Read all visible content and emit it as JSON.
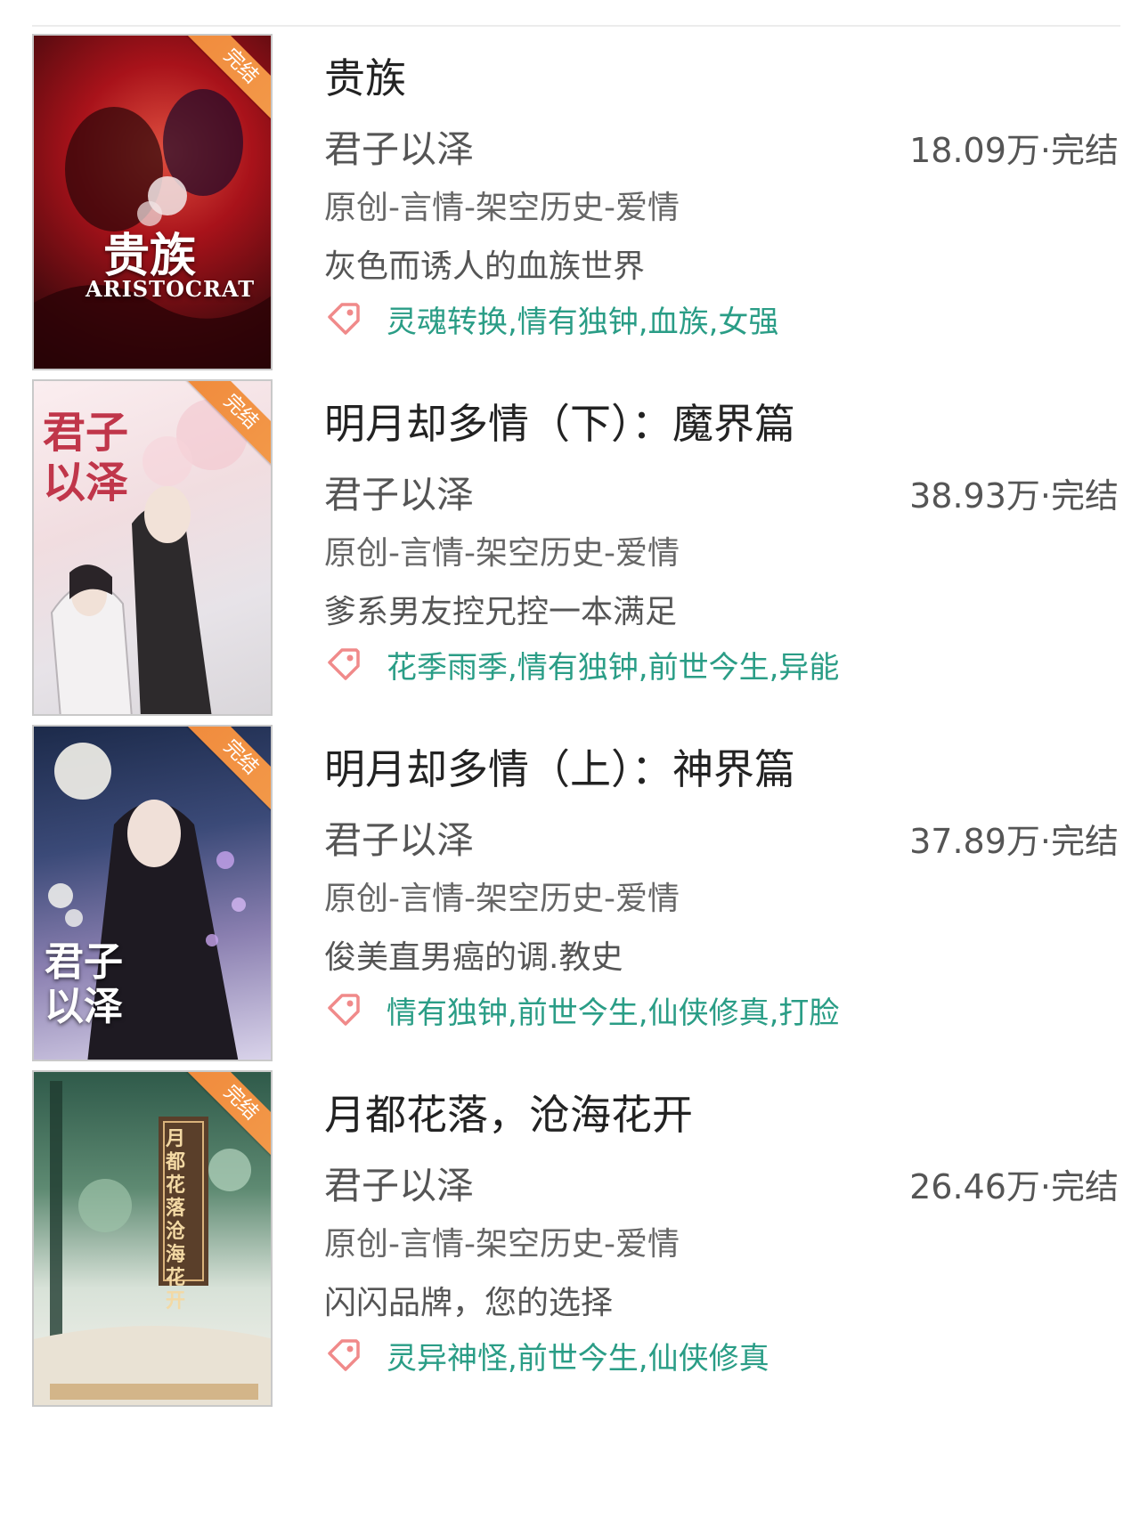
{
  "colors": {
    "tag_text": "#2a9d86",
    "ribbon": "#f08a3c",
    "tag_icon": "#f08a8a"
  },
  "books": [
    {
      "ribbon": "完结",
      "cover_text": "贵族",
      "cover_subtext": "ARISTOCRAT",
      "title": "贵族",
      "author": "君子以泽",
      "stats": "18.09万·完结",
      "category": "原创-言情-架空历史-爱情",
      "intro": "灰色而诱人的血族世界",
      "tags": "灵魂转换,情有独钟,血族,女强"
    },
    {
      "ribbon": "完结",
      "cover_text": "君子以泽",
      "title": "明月却多情（下）：魔界篇",
      "author": "君子以泽",
      "stats": "38.93万·完结",
      "category": "原创-言情-架空历史-爱情",
      "intro": "爹系男友控兄控一本满足",
      "tags": "花季雨季,情有独钟,前世今生,异能"
    },
    {
      "ribbon": "完结",
      "cover_text": "君子以泽",
      "title": "明月却多情（上）：神界篇",
      "author": "君子以泽",
      "stats": "37.89万·完结",
      "category": "原创-言情-架空历史-爱情",
      "intro": "俊美直男癌的调.教史",
      "tags": "情有独钟,前世今生,仙侠修真,打脸"
    },
    {
      "ribbon": "完结",
      "cover_text": "月都花落 沧海花开",
      "title": "月都花落，沧海花开",
      "author": "君子以泽",
      "stats": "26.46万·完结",
      "category": "原创-言情-架空历史-爱情",
      "intro": "闪闪品牌，您的选择",
      "tags": "灵异神怪,前世今生,仙侠修真"
    }
  ]
}
